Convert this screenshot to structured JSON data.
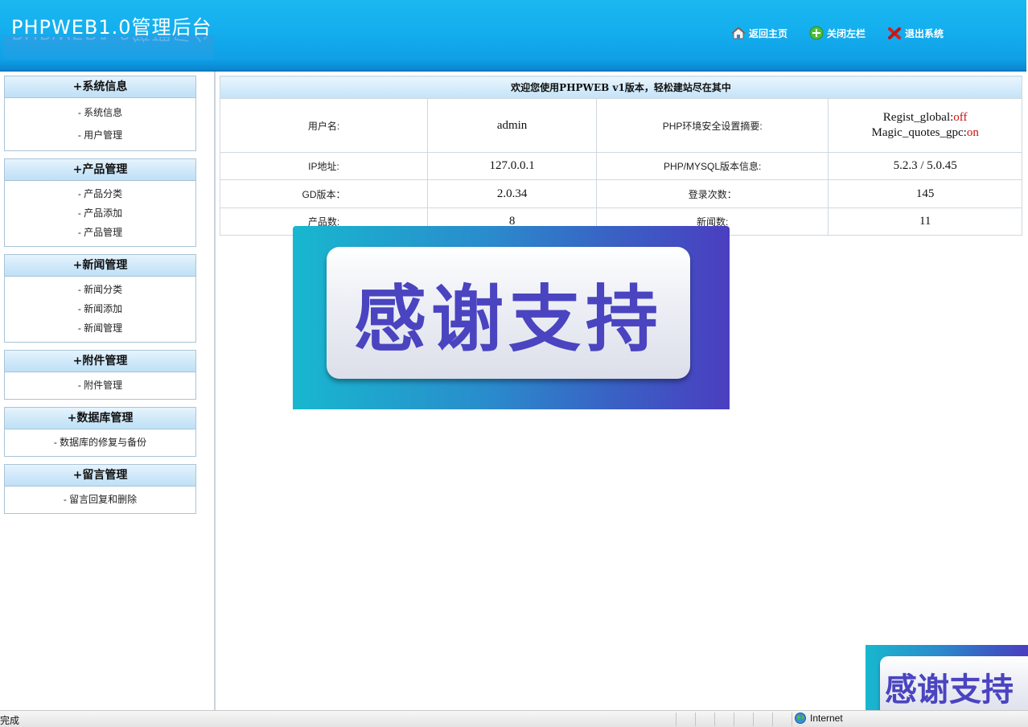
{
  "header": {
    "logo": "PHPWEB1.0管理后台",
    "links": [
      {
        "label": "返回主页",
        "icon": "home-icon"
      },
      {
        "label": "关闭左栏",
        "icon": "plus-circle-icon"
      },
      {
        "label": "退出系统",
        "icon": "close-x-icon"
      }
    ]
  },
  "sidebar": {
    "menus": [
      {
        "title": "+系统信息",
        "items": [
          "- 系统信息",
          "- 用户管理"
        ]
      },
      {
        "title": "+产品管理",
        "items": [
          "- 产品分类",
          "- 产品添加",
          "- 产品管理"
        ]
      },
      {
        "title": "+新闻管理",
        "items": [
          "- 新闻分类",
          "- 新闻添加",
          "- 新闻管理"
        ]
      },
      {
        "title": "+附件管理",
        "items": [
          "- 附件管理"
        ]
      },
      {
        "title": "+数据库管理",
        "items": [
          "- 数据库的修复与备份"
        ]
      },
      {
        "title": "+留言管理",
        "items": [
          "- 留言回复和删除"
        ]
      }
    ]
  },
  "main": {
    "welcome": "欢迎您使用PHPWEB v1版本，轻松建站尽在其中",
    "rows": [
      {
        "l1": "用户名:",
        "v1": "admin",
        "l2": "PHP环境安全设置摘要:"
      },
      {
        "l1": "IP地址:",
        "v1": "127.0.0.1",
        "l2": "PHP/MYSQL版本信息:",
        "v2": "5.2.3 / 5.0.45"
      },
      {
        "l1": "GD版本：",
        "v1": "2.0.34",
        "l2": "登录次数：",
        "v2": "145"
      },
      {
        "l1": "产品数:",
        "v1": "8",
        "l2": "新闻数:",
        "v2": "11"
      }
    ],
    "security": {
      "regist_label": "Regist_global:",
      "regist_value": "off",
      "magic_label": "Magic_quotes_gpc:",
      "magic_value": "on"
    }
  },
  "overlay": {
    "banner_text": "感谢支持",
    "corner_text": "感谢支持"
  },
  "statusbar": {
    "left": "完成",
    "zone": "Internet",
    "zone_icon": "globe-icon"
  }
}
